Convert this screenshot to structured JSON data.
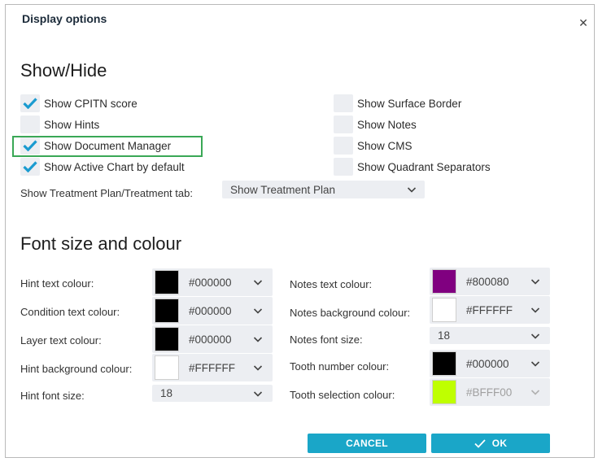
{
  "dialog": {
    "title": "Display options",
    "close_glyph": "✕"
  },
  "show_hide": {
    "title": "Show/Hide",
    "left_options": [
      {
        "label": "Show CPITN score",
        "checked": true
      },
      {
        "label": "Show Hints",
        "checked": false
      },
      {
        "label": "Show Document Manager",
        "checked": true
      },
      {
        "label": "Show Active Chart by default",
        "checked": true
      }
    ],
    "right_options": [
      {
        "label": "Show Surface Border",
        "checked": false
      },
      {
        "label": "Show Notes",
        "checked": false
      },
      {
        "label": "Show CMS",
        "checked": false
      },
      {
        "label": "Show Quadrant Separators",
        "checked": false
      }
    ],
    "treatment_tab": {
      "label": "Show Treatment Plan/Treatment tab:",
      "value": "Show Treatment Plan"
    }
  },
  "font_colour": {
    "title": "Font size and colour",
    "hint_text_colour": {
      "label": "Hint text colour:",
      "value": "#000000",
      "swatch": "#000000"
    },
    "condition_text_colour": {
      "label": "Condition text colour:",
      "value": "#000000",
      "swatch": "#000000"
    },
    "layer_text_colour": {
      "label": "Layer text colour:",
      "value": "#000000",
      "swatch": "#000000"
    },
    "hint_background_colour": {
      "label": "Hint background colour:",
      "value": "#FFFFFF",
      "swatch": "#FFFFFF"
    },
    "hint_font_size": {
      "label": "Hint font size:",
      "value": "18"
    },
    "notes_text_colour": {
      "label": "Notes text colour:",
      "value": "#800080",
      "swatch": "#800080"
    },
    "notes_background_colour": {
      "label": "Notes background colour:",
      "value": "#FFFFFF",
      "swatch": "#FFFFFF"
    },
    "notes_font_size": {
      "label": "Notes font size:",
      "value": "18"
    },
    "tooth_number_colour": {
      "label": "Tooth number colour:",
      "value": "#000000",
      "swatch": "#000000"
    },
    "tooth_selection_colour": {
      "label": "Tooth selection colour:",
      "value": "#BFFF00",
      "swatch": "#BFFF00",
      "disabled": true
    }
  },
  "buttons": {
    "cancel": "CANCEL",
    "ok": "OK"
  },
  "colors": {
    "accent": "#1aa6c8",
    "check": "#1a9bd0",
    "highlight": "#3aa856"
  }
}
